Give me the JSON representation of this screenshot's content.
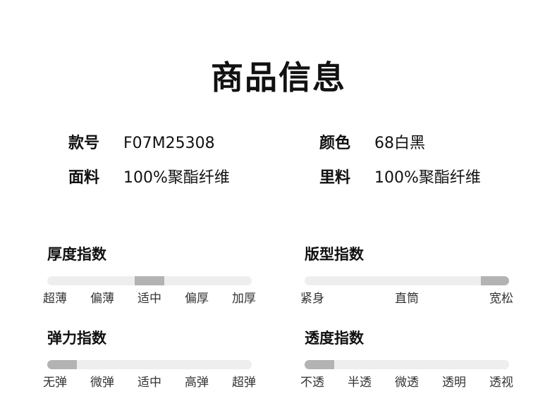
{
  "page": {
    "title": "商品信息"
  },
  "specs": {
    "style_no": {
      "label": "款号",
      "value": "F07M25308"
    },
    "color": {
      "label": "颜色",
      "value": "68白黑"
    },
    "fabric": {
      "label": "面料",
      "value": "100%聚酯纤维"
    },
    "lining": {
      "label": "里料",
      "value": "100%聚酯纤维"
    }
  },
  "indices": {
    "thickness": {
      "title": "厚度指数",
      "levels": [
        "超薄",
        "偏薄",
        "适中",
        "偏厚",
        "加厚"
      ],
      "selected": "适中",
      "selected_index": 2
    },
    "fit": {
      "title": "版型指数",
      "levels": [
        "紧身",
        "直筒",
        "宽松"
      ],
      "selected": "宽松",
      "selected_index": 2
    },
    "elasticity": {
      "title": "弹力指数",
      "levels": [
        "无弹",
        "微弹",
        "适中",
        "高弹",
        "超弹"
      ],
      "selected": "无弹",
      "selected_index": 0
    },
    "transparency": {
      "title": "透度指数",
      "levels": [
        "不透",
        "半透",
        "微透",
        "透明",
        "透视"
      ],
      "selected": "不透",
      "selected_index": 0
    }
  },
  "colors": {
    "track": "#eeeeee",
    "indicator": "#b3b3b3",
    "text": "#111111"
  }
}
